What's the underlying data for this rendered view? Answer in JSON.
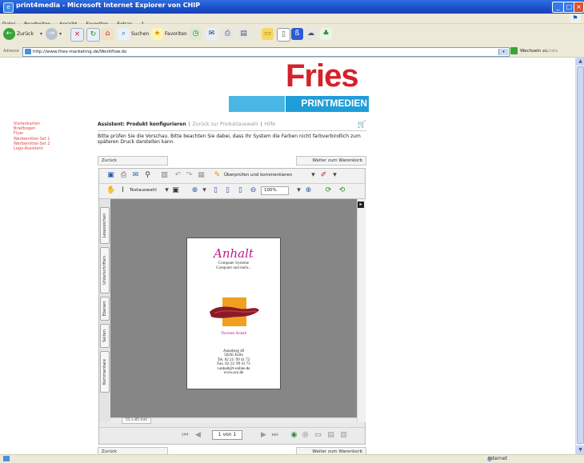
{
  "window": {
    "title": "print4media - Microsoft Internet Explorer von CHIP"
  },
  "menu": {
    "items": [
      "Datei",
      "Bearbeiten",
      "Ansicht",
      "Favoriten",
      "Extras",
      "?"
    ]
  },
  "toolbar": {
    "back_label": "Zurück",
    "search_label": "Suchen",
    "favorites_label": "Favoriten"
  },
  "address_bar": {
    "label": "Adresse",
    "url": "http://www.fries-marketing.de/Workflow.do",
    "go_label": "Wechseln zu",
    "links_label": "Links"
  },
  "logo": {
    "name": "Fries",
    "tagline": "PRINTMEDIEN"
  },
  "left_nav": {
    "items": [
      "Visitenkarten",
      "Briefbogen",
      "Flyer",
      "Werbemittel-Set 1",
      "Werbemittel-Set 2",
      "Logo-Assistent"
    ]
  },
  "breadcrumbs": {
    "current": "Assistent: Produkt konfigurieren",
    "sep": "|",
    "back_link": "Zurück zur Produktauswahl",
    "help_link": "Hilfe"
  },
  "instructions": "Bitte prüfen Sie die Vorschau. Bitte beachten Sie dabei, dass Ihr System die Farben nicht farbverbindlich zum späteren Druck darstellen kann.",
  "buttons": {
    "back": "Zurück",
    "cart": "Weiter zum Warenkorb"
  },
  "viewer": {
    "review_label": "Überprüfen und kommentieren",
    "text_select_label": "Textauswahl",
    "zoom": "100%",
    "side_tabs": [
      "Lesezeichen",
      "Unterschriften",
      "Ebenen",
      "Seiten",
      "Kommentare"
    ],
    "page_size": "55 x 85 mm",
    "page_indicator": "1 von 1"
  },
  "card": {
    "company": "Anhalt",
    "line1": "Computer Systeme",
    "line2": "Computer und mehr...",
    "person": "Thorsten Anhalt",
    "address": [
      "Annoberg 40",
      "50265 Köln",
      "Tel. 02 21/ 99 41 72",
      "Fax. 02 21/ 99 41 73",
      "t.anhalt@t-online.de",
      "www.aco.de"
    ]
  },
  "status": {
    "zone": "Internet"
  },
  "colors": {
    "brand_red": "#d4222a",
    "brand_blue": "#1f9dd8",
    "nav_link": "#e04646",
    "card_magenta": "#c01a8a"
  }
}
